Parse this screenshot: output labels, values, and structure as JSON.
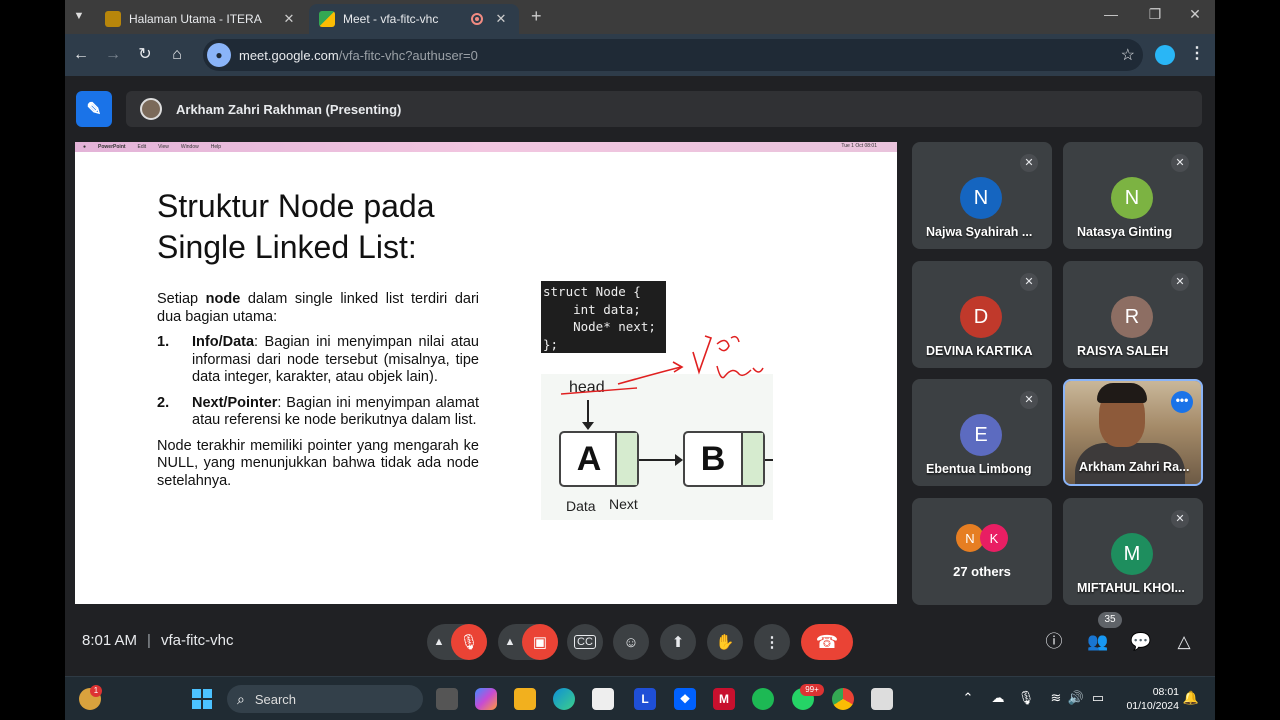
{
  "browser": {
    "tabs": [
      {
        "title": "Halaman Utama - ITERA",
        "active": false
      },
      {
        "title": "Meet - vfa-fitc-vhc",
        "active": true
      }
    ],
    "url_host": "meet.google.com",
    "url_path": "/vfa-fitc-vhc?authuser=0"
  },
  "meet": {
    "presenter_label": "Arkham Zahri Rakhman (Presenting)",
    "time": "8:01 AM",
    "meeting_code": "vfa-fitc-vhc",
    "participant_count": "35"
  },
  "slide": {
    "title_line1": "Struktur Node pada",
    "title_line2": "Single Linked List:",
    "intro_pre": "Setiap ",
    "intro_bold": "node",
    "intro_post": " dalam single linked list terdiri dari dua bagian utama:",
    "items": [
      {
        "num": "1.",
        "bold": "Info/Data",
        "text": ": Bagian ini menyimpan nilai atau informasi dari node tersebut (misalnya, tipe data integer, karakter, atau objek lain)."
      },
      {
        "num": "2.",
        "bold": "Next/Pointer",
        "text": ": Bagian ini menyimpan alamat atau referensi ke node berikutnya dalam list."
      }
    ],
    "outro": "Node terakhir memiliki pointer yang mengarah ke NULL, yang menunjukkan bahwa tidak ada node setelahnya.",
    "code_lines": [
      "struct Node {",
      "    int data;",
      "    Node* next;",
      "};"
    ],
    "diagram": {
      "head_label": "head",
      "node_a": "A",
      "node_b": "B",
      "label_data": "Data",
      "label_next": "Next"
    },
    "menubar": {
      "app": "PowerPoint",
      "items": [
        "Edit",
        "View",
        "Window",
        "Help"
      ],
      "clock": "Tue 1 Oct 08:01"
    }
  },
  "participants": [
    {
      "name": "Najwa Syahirah ...",
      "initial": "N",
      "color": "#1565c0",
      "muted": true
    },
    {
      "name": "Natasya Ginting",
      "initial": "N",
      "color": "#7cb342",
      "muted": true
    },
    {
      "name": "DEVINA KARTIKA",
      "initial": "D",
      "color": "#c0392b",
      "muted": true
    },
    {
      "name": "RAISYA SALEH",
      "initial": "R",
      "color": "#8d6e63",
      "muted": true
    },
    {
      "name": "Ebentua Limbong",
      "initial": "E",
      "color": "#5c6bc0",
      "muted": true
    },
    {
      "name": "Arkham Zahri Ra...",
      "initial": "",
      "color": "",
      "muted": false
    },
    {
      "name": "27 others",
      "initial": "",
      "color": "",
      "muted": false
    },
    {
      "name": "MIFTAHUL KHOI...",
      "initial": "M",
      "color": "#1e8e5e",
      "muted": true
    }
  ],
  "others_avatars": [
    {
      "initial": "N",
      "color": "#e67e22"
    },
    {
      "initial": "K",
      "color": "#e91e63"
    }
  ],
  "taskbar": {
    "search_label": "Search",
    "clock_time": "08:01",
    "clock_date": "01/10/2024",
    "whatsapp_badge": "99+",
    "widget_badge": "1"
  }
}
